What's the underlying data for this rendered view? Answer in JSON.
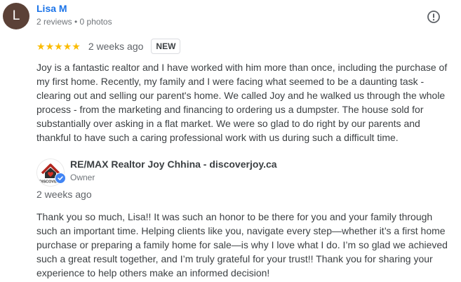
{
  "review": {
    "reviewer": {
      "initial": "L",
      "name": "Lisa M",
      "meta": "2 reviews • 0 photos",
      "avatar_color": "#5b4137"
    },
    "rating": 5,
    "rating_max": 5,
    "time": "2 weeks ago",
    "badge": "NEW",
    "text": "Joy is a fantastic realtor and I have worked with him more than once, including the purchase of my first home. Recently, my family and I were facing what seemed to be a daunting task - clearing out and selling our parent's home. We called Joy and he walked us through the whole process - from the marketing and financing to ordering us a dumpster. The house sold for substantially over asking in a flat market. We were so glad to do right by our parents and thankful to have such a caring professional work with us during such a difficult time.",
    "report_icon": "report-icon"
  },
  "owner_response": {
    "name": "RE/MAX Realtor Joy Chhina - discoverjoy.ca",
    "role": "Owner",
    "logo_text": "DISCOVER",
    "time": "2 weeks ago",
    "text": "Thank you so much, Lisa!! It was such an honor to be there for you and your family through such an important time. Helping clients like you, navigate every step—whether it’s a first home purchase or preparing a family home for sale—is why I love what I do. I’m so glad we achieved such a great result together, and I’m truly grateful for your trust!! Thank you for sharing your experience to help others make an informed decision!"
  },
  "colors": {
    "name_link": "#1a73e8",
    "star": "#fbbc04",
    "verified": "#4285f4"
  }
}
